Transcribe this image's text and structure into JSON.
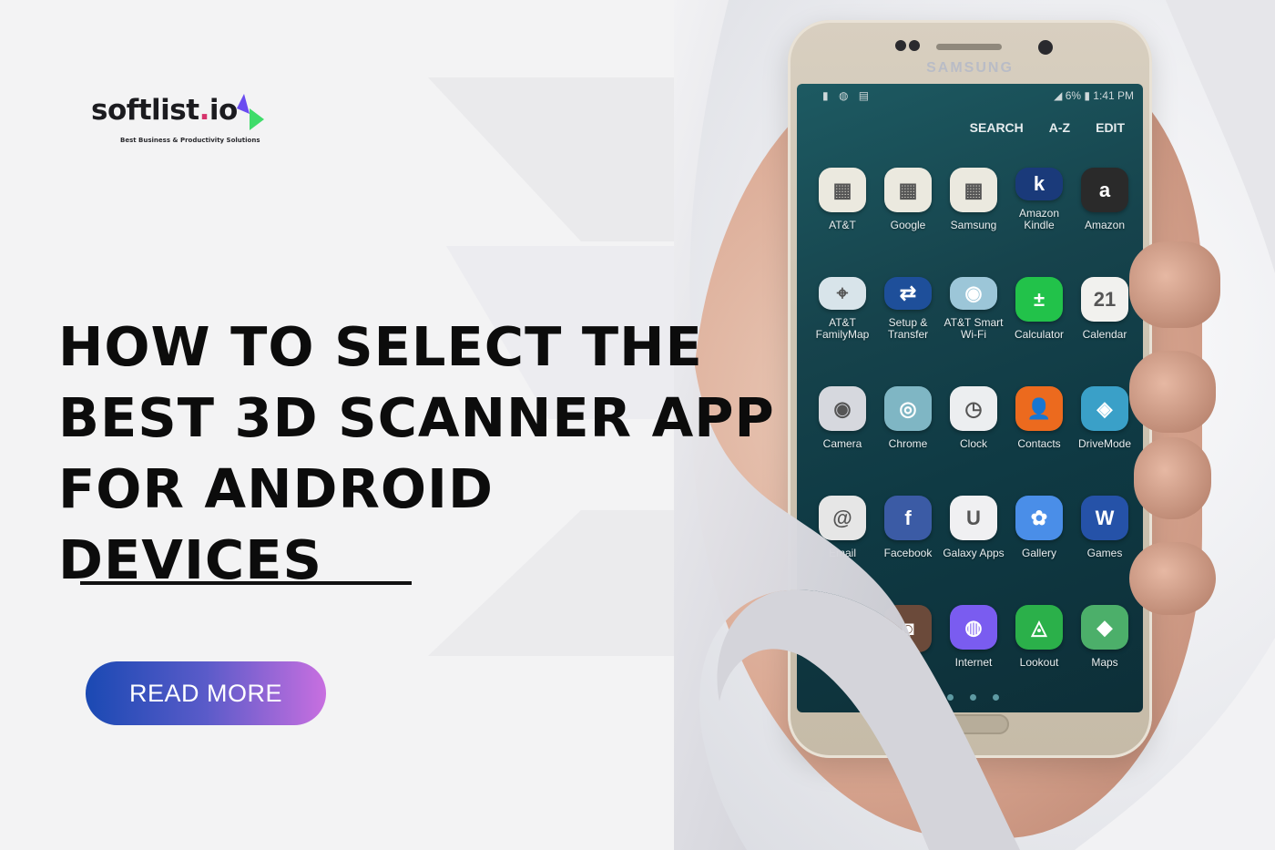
{
  "brand": {
    "name_main": "softlist",
    "name_dot": ".",
    "name_tld": "io",
    "tagline": "Best Business & Productivity Solutions",
    "mark_colors": {
      "triangle_top": "#6a4cf0",
      "triangle_right": "#3fdc6a",
      "dot": "#d6336c"
    }
  },
  "headline": {
    "lines": [
      "How to Select the",
      "Best 3D Scanner App",
      "for Android",
      "Devices"
    ]
  },
  "cta": {
    "label": "READ MORE",
    "gradient": [
      "#1a49b3",
      "#5a5bc9",
      "#c86fe0"
    ]
  },
  "phone": {
    "brand": "SAMSUNG",
    "status_right": "◢ 6% ▮ 1:41 PM",
    "status_left": "▮ ◍ ▤",
    "actions": [
      "SEARCH",
      "A-Z",
      "EDIT"
    ],
    "apps": [
      {
        "label": "AT&T",
        "glyph": "▦",
        "color": "#ebe9df"
      },
      {
        "label": "Google",
        "glyph": "▦",
        "color": "#ebe9df"
      },
      {
        "label": "Samsung",
        "glyph": "▦",
        "color": "#ebe9df"
      },
      {
        "label": "Amazon Kindle",
        "glyph": "k",
        "color": "#1a3a7a"
      },
      {
        "label": "Amazon",
        "glyph": "a",
        "color": "#2a2a2a"
      },
      {
        "label": "AT&T FamilyMap",
        "glyph": "⌖",
        "color": "#d8e4ea"
      },
      {
        "label": "Setup & Transfer",
        "glyph": "⇄",
        "color": "#1e4f9a"
      },
      {
        "label": "AT&T Smart Wi-Fi",
        "glyph": "◉",
        "color": "#9cc6d8"
      },
      {
        "label": "Calculator",
        "glyph": "±",
        "color": "#22c24a"
      },
      {
        "label": "Calendar",
        "glyph": "21",
        "color": "#f1f1ee"
      },
      {
        "label": "Camera",
        "glyph": "◉",
        "color": "#d6d8de"
      },
      {
        "label": "Chrome",
        "glyph": "◎",
        "color": "#7fb6c4"
      },
      {
        "label": "Clock",
        "glyph": "◷",
        "color": "#eceef0"
      },
      {
        "label": "Contacts",
        "glyph": "👤",
        "color": "#ec6a1e"
      },
      {
        "label": "DriveMode",
        "glyph": "◈",
        "color": "#3aa0c8"
      },
      {
        "label": "Email",
        "glyph": "@",
        "color": "#e6e6e6"
      },
      {
        "label": "Facebook",
        "glyph": "f",
        "color": "#3b5ba5"
      },
      {
        "label": "Galaxy Apps",
        "glyph": "U",
        "color": "#f0f0f2"
      },
      {
        "label": "Gallery",
        "glyph": "✿",
        "color": "#4a8ee8"
      },
      {
        "label": "Games",
        "glyph": "W",
        "color": "#2552a8"
      },
      {
        "label": "",
        "glyph": "",
        "color": "transparent"
      },
      {
        "label": "",
        "glyph": "◙",
        "color": "#6b4a3a"
      },
      {
        "label": "Internet",
        "glyph": "◍",
        "color": "#7a5cf0"
      },
      {
        "label": "Lookout",
        "glyph": "◬",
        "color": "#2bb04a"
      },
      {
        "label": "Maps",
        "glyph": "◆",
        "color": "#4caf6a"
      }
    ]
  }
}
